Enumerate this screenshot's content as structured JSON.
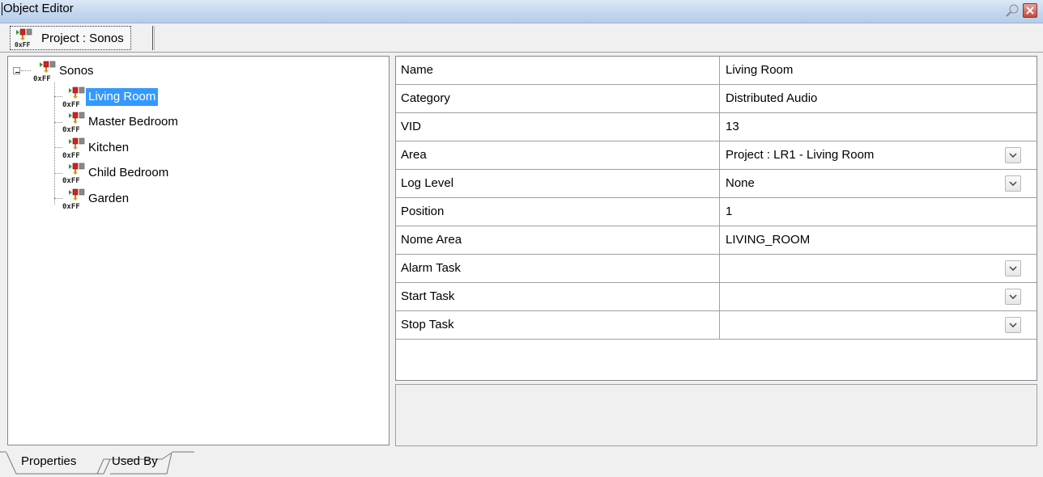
{
  "window": {
    "title": "Object Editor"
  },
  "doc_tab": {
    "label": "Project : Sonos"
  },
  "tree": {
    "root": {
      "label": "Sonos",
      "expander": "⊟"
    },
    "children": [
      {
        "label": "Living Room",
        "selected": true
      },
      {
        "label": "Master Bedroom",
        "selected": false
      },
      {
        "label": "Kitchen",
        "selected": false
      },
      {
        "label": "Child Bedroom",
        "selected": false
      },
      {
        "label": "Garden",
        "selected": false
      }
    ],
    "icon_caption": "0xFF"
  },
  "properties": [
    {
      "name": "Name",
      "value": "Living Room",
      "dropdown": false
    },
    {
      "name": "Category",
      "value": "Distributed Audio",
      "dropdown": false
    },
    {
      "name": "VID",
      "value": "13",
      "dropdown": false
    },
    {
      "name": "Area",
      "value": "Project : LR1 - Living Room",
      "dropdown": true
    },
    {
      "name": "Log Level",
      "value": "None",
      "dropdown": true
    },
    {
      "name": "Position",
      "value": "1",
      "dropdown": false
    },
    {
      "name": "Nome Area",
      "value": "LIVING_ROOM",
      "dropdown": false
    },
    {
      "name": "Alarm Task",
      "value": "",
      "dropdown": true
    },
    {
      "name": "Start Task",
      "value": "",
      "dropdown": true
    },
    {
      "name": "Stop Task",
      "value": "",
      "dropdown": true
    }
  ],
  "bottom_tabs": [
    {
      "label": "Properties",
      "active": true
    },
    {
      "label": "Used By",
      "active": false
    }
  ],
  "icons": {
    "device": "device-node-icon",
    "dropdown": "chevron-down-icon",
    "pin": "pin-icon",
    "close": "close-icon"
  },
  "colors": {
    "selection": "#3399ff",
    "titlebar": "#c2d6ee",
    "grid_line": "#a0a0a0"
  }
}
